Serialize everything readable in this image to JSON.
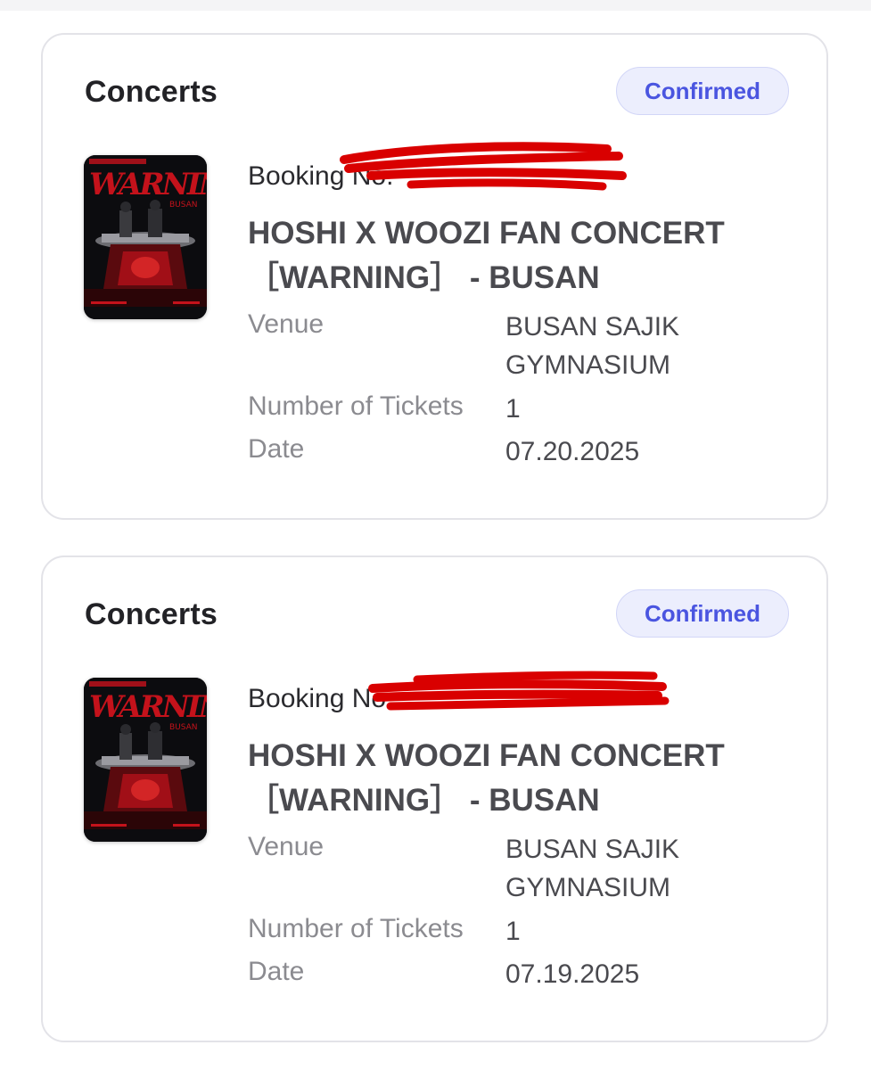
{
  "bookings": [
    {
      "category": "Concerts",
      "status": "Confirmed",
      "booking_label": "Booking No.",
      "title_line1": "HOSHI X WOOZI FAN CONCERT",
      "title_line2": "［WARNING］ - BUSAN",
      "venue_label": "Venue",
      "venue_value": "BUSAN SAJIK GYMNASIUM",
      "tickets_label": "Number of Tickets",
      "tickets_value": "1",
      "date_label": "Date",
      "date_value": "07.20.2025"
    },
    {
      "category": "Concerts",
      "status": "Confirmed",
      "booking_label": "Booking No.",
      "title_line1": "HOSHI X WOOZI FAN CONCERT",
      "title_line2": "［WARNING］ - BUSAN",
      "venue_label": "Venue",
      "venue_value": "BUSAN SAJIK GYMNASIUM",
      "tickets_label": "Number of Tickets",
      "tickets_value": "1",
      "date_label": "Date",
      "date_value": "07.19.2025"
    }
  ],
  "poster": {
    "text": "WARNING",
    "subtext": "BUSAN"
  },
  "colors": {
    "badge_text": "#4a55e0",
    "badge_bg": "#eceefd",
    "redaction": "#d90000",
    "poster_red": "#c4121b"
  },
  "icons": {
    "poster": "concert-poster-image",
    "redaction": "red-scribble-redaction"
  }
}
